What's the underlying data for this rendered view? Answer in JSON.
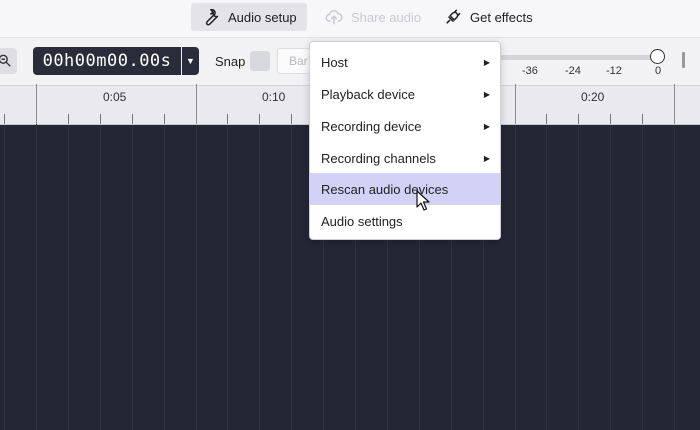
{
  "toolbar": {
    "audio_setup": "Audio setup",
    "share_audio": "Share audio",
    "get_effects": "Get effects"
  },
  "transport": {
    "timecode": "00h00m00.00s",
    "snap_label": "Snap",
    "snap_select": "Bar"
  },
  "meter": {
    "ticks": [
      "-36",
      "-24",
      "-12",
      "0"
    ]
  },
  "ruler": {
    "labels": [
      "0:05",
      "0:10",
      "0:20"
    ]
  },
  "menu": {
    "items": [
      {
        "label": "Host",
        "has_submenu": true
      },
      {
        "label": "Playback device",
        "has_submenu": true
      },
      {
        "label": "Recording device",
        "has_submenu": true
      },
      {
        "label": "Recording channels",
        "has_submenu": true
      },
      {
        "label": "Rescan audio devices",
        "has_submenu": false,
        "highlighted": true
      },
      {
        "label": "Audio settings",
        "has_submenu": false
      }
    ]
  },
  "colors": {
    "track_bg": "#242636",
    "menu_highlight": "#d3d1f5",
    "timecode_bg": "#2a2c3a"
  }
}
